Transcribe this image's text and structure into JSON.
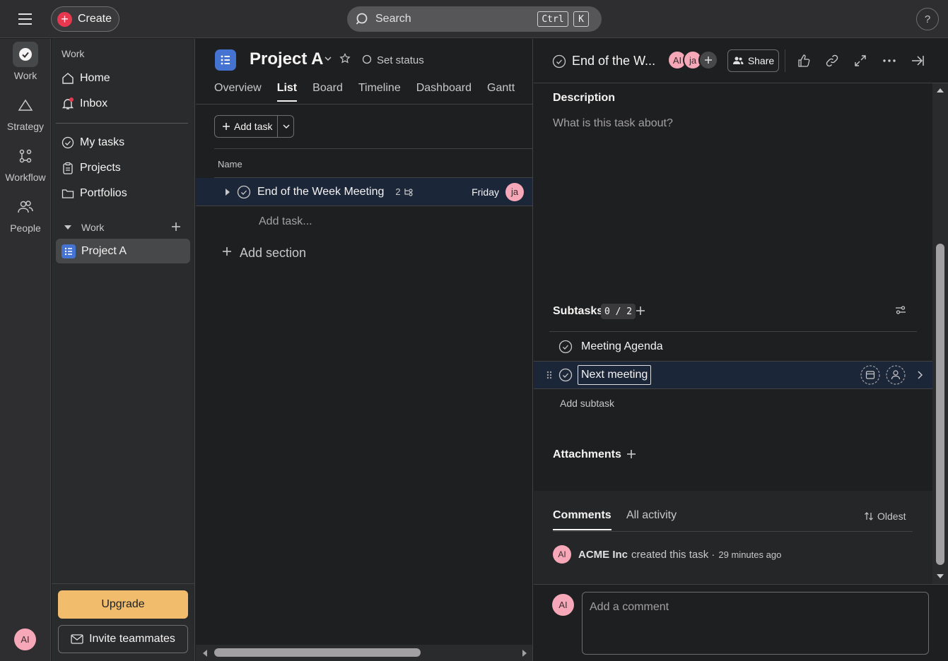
{
  "topbar": {
    "create_label": "Create",
    "search_label": "Search",
    "shortcut_key1": "Ctrl",
    "shortcut_key2": "K",
    "help_label": "?"
  },
  "rail": {
    "items": [
      {
        "label": "Work",
        "icon": "check-circle-icon"
      },
      {
        "label": "Strategy",
        "icon": "triangle-icon"
      },
      {
        "label": "Workflow",
        "icon": "workflow-icon"
      },
      {
        "label": "People",
        "icon": "people-icon"
      }
    ],
    "avatar": "AI"
  },
  "sidebar": {
    "heading": "Work",
    "nav": [
      {
        "label": "Home",
        "icon": "home-icon"
      },
      {
        "label": "Inbox",
        "icon": "bell-icon"
      }
    ],
    "nav2": [
      {
        "label": "My tasks",
        "icon": "check-circle-icon"
      },
      {
        "label": "Projects",
        "icon": "clipboard-icon"
      },
      {
        "label": "Portfolios",
        "icon": "folder-icon"
      }
    ],
    "section": "Work",
    "project_item": "Project A",
    "upgrade": "Upgrade",
    "invite": "Invite teammates"
  },
  "project": {
    "title": "Project A",
    "set_status": "Set status",
    "tabs": [
      "Overview",
      "List",
      "Board",
      "Timeline",
      "Dashboard",
      "Gantt"
    ],
    "active_tab": "List",
    "add_task": "Add task",
    "column_name": "Name",
    "task": {
      "name": "End of the Week Meeting",
      "subtask_count": "2",
      "due": "Friday",
      "assignee": "ja"
    },
    "add_task_placeholder": "Add task...",
    "add_section": "Add section"
  },
  "detail": {
    "title": "End of the W...",
    "collaborators": [
      "AI",
      "ja"
    ],
    "share": "Share",
    "description_label": "Description",
    "description_placeholder": "What is this task about?",
    "subtasks_label": "Subtasks",
    "subtasks_count": "0 / 2",
    "subtasks": [
      "Meeting Agenda",
      "Next meeting"
    ],
    "add_subtask": "Add subtask",
    "attachments_label": "Attachments",
    "comments_tab": "Comments",
    "activity_tab": "All activity",
    "sort_label": "Oldest",
    "activity_avatar": "AI",
    "activity_author": "ACME Inc",
    "activity_text": "created this task ·",
    "activity_time": "29 minutes ago",
    "comment_avatar": "AI",
    "comment_placeholder": "Add a comment"
  }
}
